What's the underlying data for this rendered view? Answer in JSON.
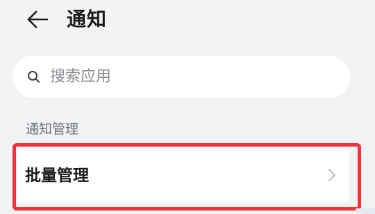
{
  "header": {
    "title": "通知",
    "back_icon": "arrow-left-icon"
  },
  "search": {
    "placeholder": "搜索应用",
    "value": "",
    "icon": "search-icon"
  },
  "section": {
    "label": "通知管理"
  },
  "list": {
    "items": [
      {
        "label": "批量管理",
        "icon": "chevron-right-icon"
      }
    ]
  },
  "colors": {
    "background": "#f1f3f5",
    "card": "#ffffff",
    "highlight": "#f0323a",
    "text_primary": "#1b1b1b",
    "text_secondary": "#6e7176"
  }
}
